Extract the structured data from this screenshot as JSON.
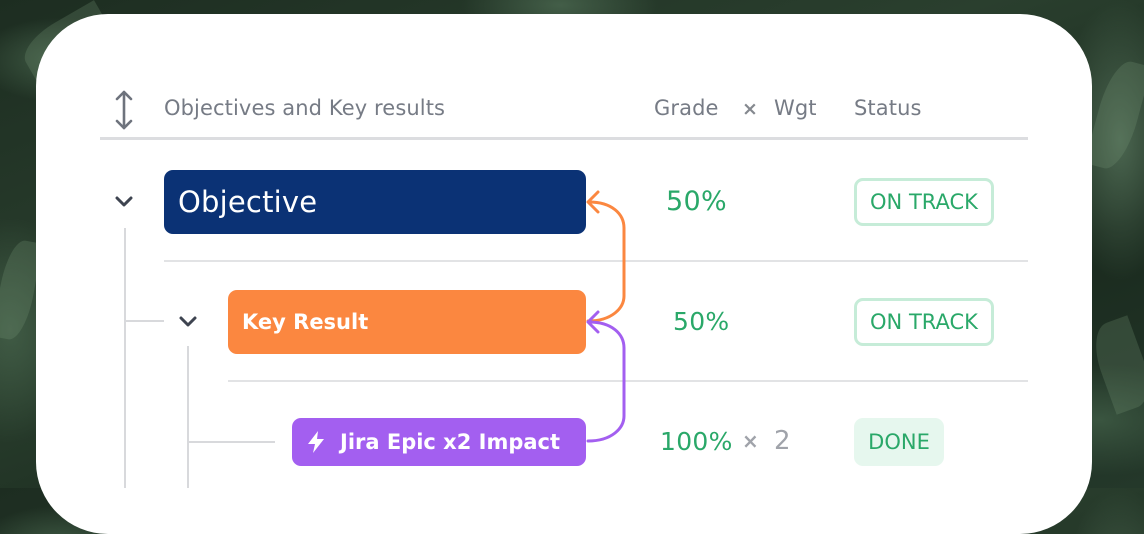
{
  "header": {
    "title": "Objectives and Key results",
    "grade": "Grade",
    "times": "×",
    "weight": "Wgt",
    "status": "Status"
  },
  "rows": [
    {
      "label": "Objective",
      "grade": "50%",
      "status": "ON TRACK",
      "color": "#0b3275"
    },
    {
      "label": "Key Result",
      "grade": "50%",
      "status": "ON TRACK",
      "color": "#fb8740"
    },
    {
      "label": "Jira Epic x2 Impact",
      "grade": "100%",
      "times": "×",
      "weight": "2",
      "status": "DONE",
      "color": "#a35ff0",
      "icon": "lightning-bolt-icon"
    }
  ],
  "colors": {
    "grade_green": "#2aa869",
    "link_orange": "#fb8740",
    "link_purple": "#a35ff0"
  }
}
